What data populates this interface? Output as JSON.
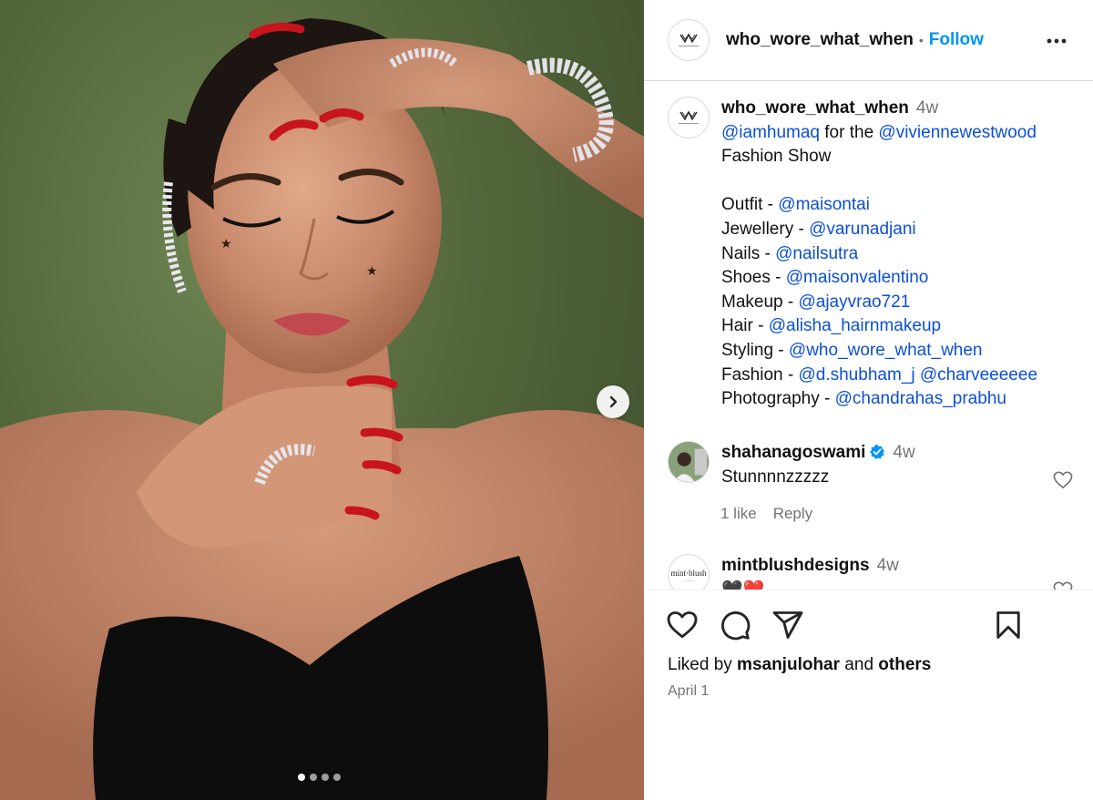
{
  "photo": {
    "carousel_total": 4,
    "carousel_active": 1
  },
  "post": {
    "author": "who_wore_what_when",
    "follow_label": "Follow",
    "separator": "•"
  },
  "caption": {
    "author": "who_wore_what_when",
    "time": "4w",
    "line1_mention1": "@iamhumaq",
    "line1_text": " for the ",
    "line1_mention2": "@viviennewestwood",
    "line2": "Fashion Show",
    "credits": [
      {
        "label": "Outfit - ",
        "mentions": [
          "@maisontai"
        ]
      },
      {
        "label": "Jewellery - ",
        "mentions": [
          "@varunadjani"
        ]
      },
      {
        "label": "Nails - ",
        "mentions": [
          "@nailsutra"
        ]
      },
      {
        "label": "Shoes - ",
        "mentions": [
          "@maisonvalentino"
        ]
      },
      {
        "label": "Makeup - ",
        "mentions": [
          "@ajayvrao721"
        ]
      },
      {
        "label": "Hair - ",
        "mentions": [
          "@alisha_hairnmakeup"
        ]
      },
      {
        "label": "Styling - ",
        "mentions": [
          "@who_wore_what_when"
        ]
      },
      {
        "label": "Fashion - ",
        "mentions": [
          "@d.shubham_j",
          "@charveeeeee"
        ]
      },
      {
        "label": "Photography - ",
        "mentions": [
          "@chandrahas_prabhu"
        ]
      }
    ]
  },
  "comments": [
    {
      "user": "shahanagoswami",
      "verified": true,
      "time": "4w",
      "text": "Stunnnnzzzzz",
      "likes": "1 like",
      "reply": "Reply"
    },
    {
      "user": "mintblushdesigns",
      "verified": false,
      "time": "4w",
      "text": "🖤❤️"
    }
  ],
  "footer": {
    "liked_prefix": "Liked by ",
    "liked_user": "msanjulohar",
    "liked_middle": " and ",
    "liked_others": "others",
    "date": "April 1"
  },
  "colors": {
    "link": "#0b4fd6",
    "follow": "#0095f6",
    "muted": "#737373",
    "verified": "#0095f6"
  },
  "icons": [
    "next-arrow-icon",
    "more-options-icon",
    "like-icon",
    "comment-icon",
    "share-icon",
    "save-icon",
    "verified-icon"
  ]
}
